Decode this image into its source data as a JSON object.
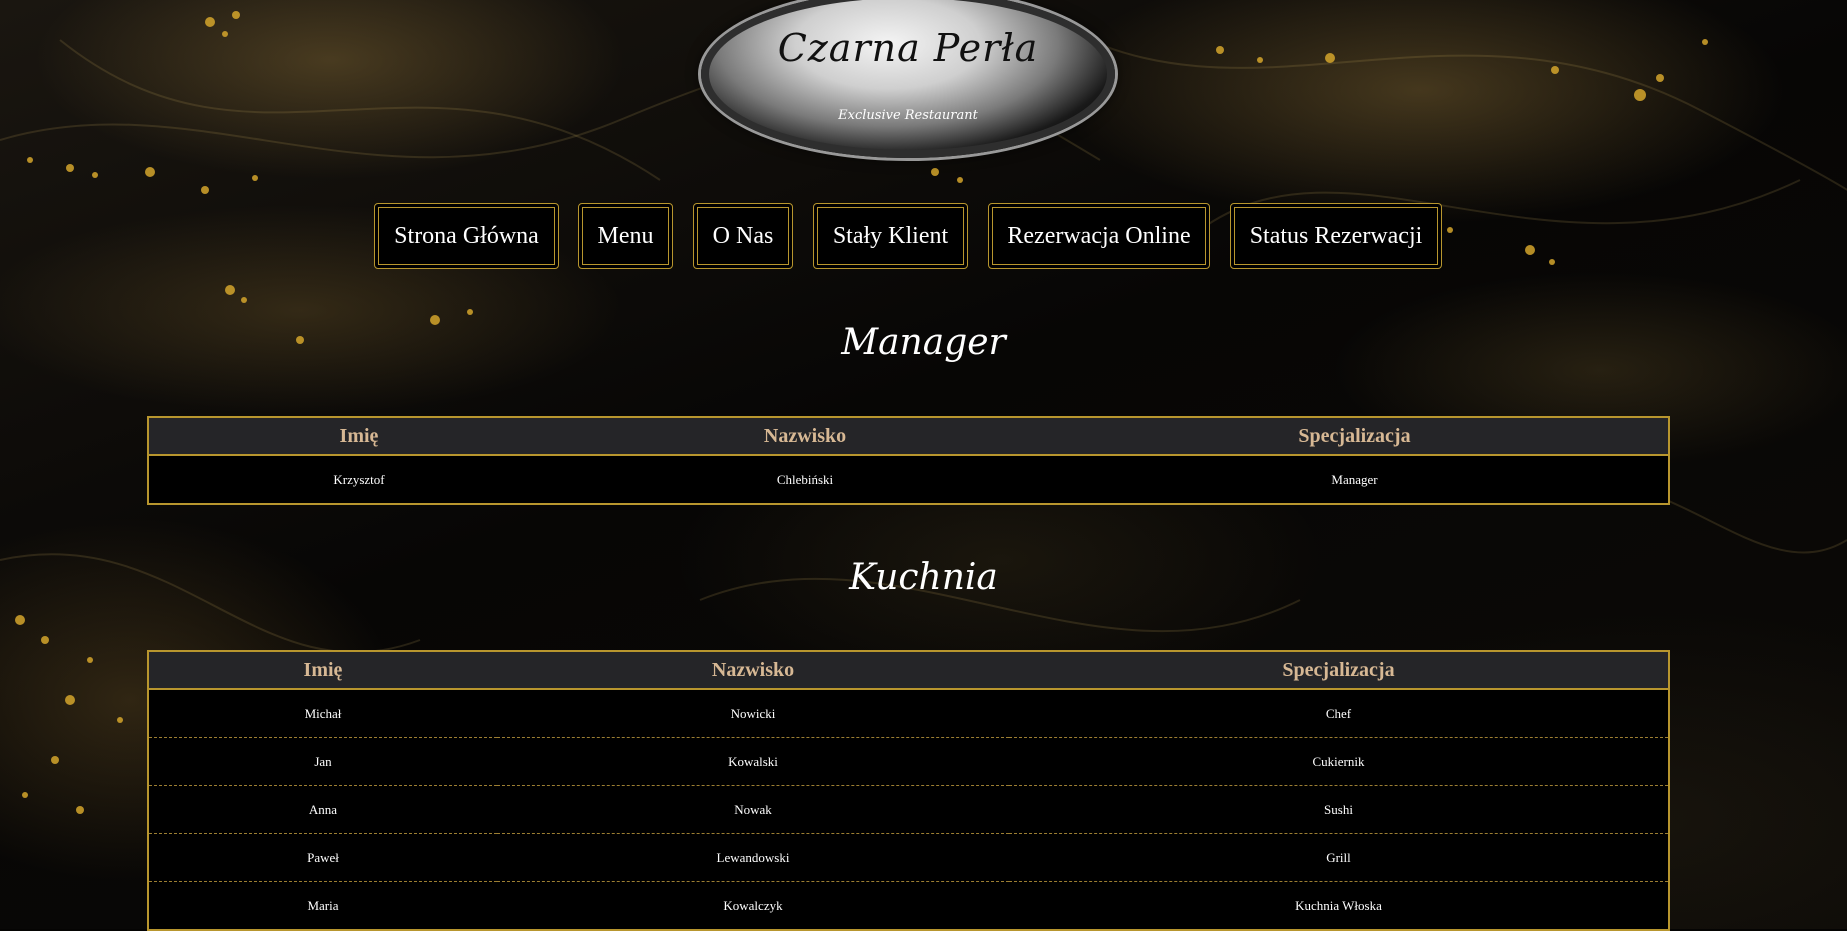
{
  "logo": {
    "title": "Czarna Perła",
    "subtitle": "Exclusive Restaurant"
  },
  "nav": {
    "items": [
      {
        "label": "Strona Główna"
      },
      {
        "label": "Menu"
      },
      {
        "label": "O Nas"
      },
      {
        "label": "Stały Klient"
      },
      {
        "label": "Rezerwacja Online"
      },
      {
        "label": "Status Rezerwacji"
      }
    ]
  },
  "sections": {
    "manager": {
      "title": "Manager",
      "headers": [
        "Imię",
        "Nazwisko",
        "Specjalizacja"
      ],
      "rows": [
        [
          "Krzysztof",
          "Chlebiński",
          "Manager"
        ]
      ]
    },
    "kitchen": {
      "title": "Kuchnia",
      "headers": [
        "Imię",
        "Nazwisko",
        "Specjalizacja"
      ],
      "rows": [
        [
          "Michał",
          "Nowicki",
          "Chef"
        ],
        [
          "Jan",
          "Kowalski",
          "Cukiernik"
        ],
        [
          "Anna",
          "Nowak",
          "Sushi"
        ],
        [
          "Paweł",
          "Lewandowski",
          "Grill"
        ],
        [
          "Maria",
          "Kowalczyk",
          "Kuchnia Włoska"
        ]
      ]
    }
  },
  "colors": {
    "accent_gold": "#b8962e",
    "header_text": "#d7b894",
    "header_bg": "#252528",
    "table_bg": "#000000"
  }
}
